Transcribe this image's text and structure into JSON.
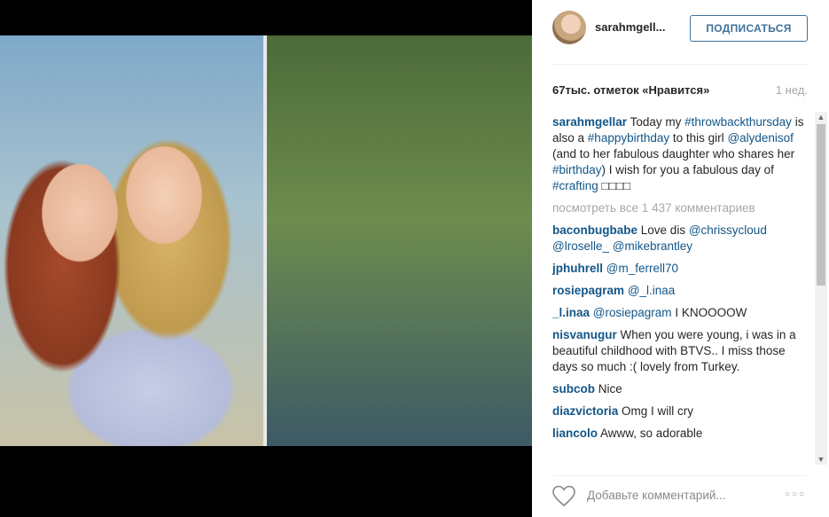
{
  "post": {
    "username": "sarahmgell...",
    "follow_label": "ПОДПИСАТЬСЯ",
    "likes": "67тыс. отметок «Нравится»",
    "time_ago": "1 нед."
  },
  "caption": {
    "user": "sarahmgellar",
    "t1": "Today my",
    "tag1": "#throwbackthursday",
    "t2": "is also a",
    "tag2": "#happybirthday",
    "t3": "to this girl",
    "mention1": "@alydenisof",
    "t4": "(and to her fabulous daughter who shares her",
    "tag3": "#birthday",
    "t5": ") I wish for you a fabulous day of",
    "tag4": "#crafting",
    "emoji": "□□□□"
  },
  "view_all": "посмотреть все 1 437 комментариев",
  "comments": [
    {
      "user": "baconbugbabe",
      "text": "Love dis",
      "mentions": [
        "@chrissycloud",
        "@lroselle_",
        "@mikebrantley"
      ]
    },
    {
      "user": "jphuhrell",
      "mention": "@m_ferrell70"
    },
    {
      "user": "rosiepagram",
      "mention": "@_l.inaa"
    },
    {
      "user": "_l.inaa",
      "mention": "@rosiepagram",
      "text": "I KNOOOOW"
    },
    {
      "user": "nisvanugur",
      "text": "When you were young, i was in a beautiful childhood with BTVS.. I miss those days so much :( lovely from Turkey."
    },
    {
      "user": "subcob",
      "text": "Nice"
    },
    {
      "user": "diazvictoria",
      "text": "Omg I will cry"
    },
    {
      "user": "liancolo",
      "text": "Awww, so adorable"
    }
  ],
  "add_comment_placeholder": "Добавьте комментарий...",
  "more_label": "○○○",
  "icons": {
    "like": "heart-icon",
    "more": "more-options-icon",
    "scroll_up": "scroll-up-icon",
    "scroll_down": "scroll-down-icon"
  },
  "colors": {
    "link": "#125688",
    "follow_button": "#3f729b",
    "muted": "#a5a7aa"
  }
}
